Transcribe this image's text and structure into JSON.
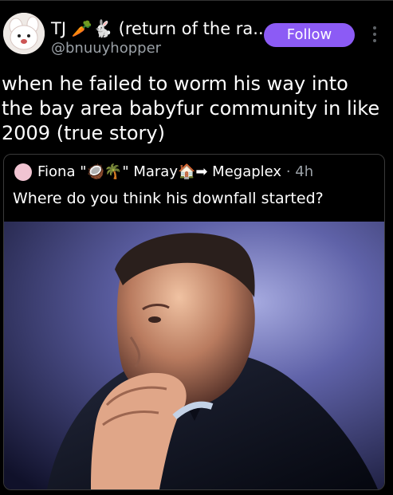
{
  "post": {
    "display_name": "TJ 🥕🐇 (return of the ra...",
    "handle": "@bnuuyhopper",
    "follow_label": "Follow",
    "text": "when he failed to worm his way into the bay area babyfur community in like 2009 (true story)"
  },
  "quoted_post": {
    "header": "Fiona \"🥥🌴\" Maray🏠➡ Megaplex",
    "time": "· 4h",
    "text": "Where do you think his downfall started?"
  },
  "icons": {
    "avatar": "bunny-avatar",
    "more": "vertical-ellipsis-icon"
  },
  "colors": {
    "background": "#000000",
    "follow_button": "#8c5bf5",
    "secondary_text": "#9aa0a6"
  }
}
